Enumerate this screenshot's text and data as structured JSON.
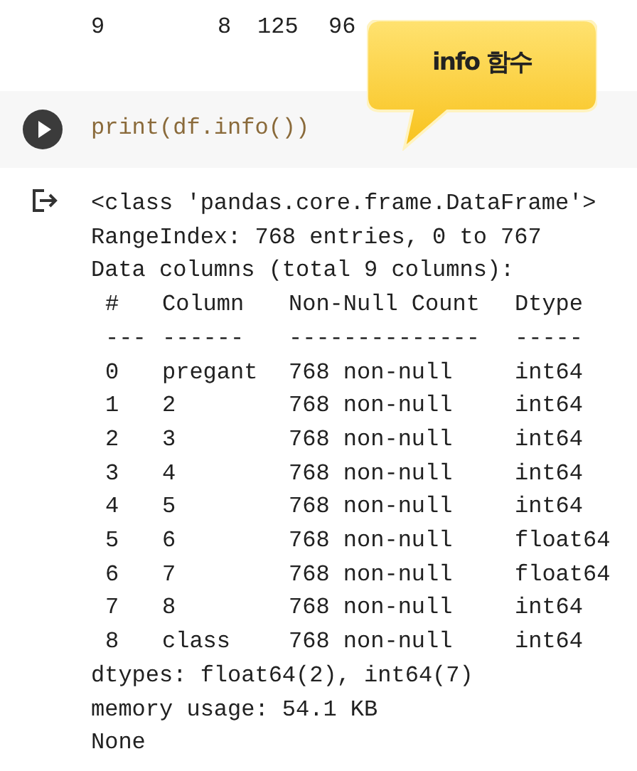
{
  "previous_output_row": [
    "9",
    "8",
    "125",
    "96"
  ],
  "callout": {
    "text": "info 함수"
  },
  "code_cell": {
    "code": "print(df.info())"
  },
  "output": {
    "header_lines": [
      "<class 'pandas.core.frame.DataFrame'>",
      "RangeIndex: 768 entries, 0 to 767",
      "Data columns (total 9 columns):"
    ],
    "columns": [
      "#",
      "Column",
      "Non-Null Count",
      "Dtype"
    ],
    "separators": [
      "---",
      "------",
      "--------------",
      "-----"
    ],
    "rows": [
      [
        "0",
        "pregant",
        "768 non-null",
        "int64"
      ],
      [
        "1",
        "2",
        "768 non-null",
        "int64"
      ],
      [
        "2",
        "3",
        "768 non-null",
        "int64"
      ],
      [
        "3",
        "4",
        "768 non-null",
        "int64"
      ],
      [
        "4",
        "5",
        "768 non-null",
        "int64"
      ],
      [
        "5",
        "6",
        "768 non-null",
        "float64"
      ],
      [
        "6",
        "7",
        "768 non-null",
        "float64"
      ],
      [
        "7",
        "8",
        "768 non-null",
        "int64"
      ],
      [
        "8",
        "class",
        "768 non-null",
        "int64"
      ]
    ],
    "footer_lines": [
      "dtypes: float64(2), int64(7)",
      "memory usage: 54.1 KB",
      "None"
    ]
  }
}
